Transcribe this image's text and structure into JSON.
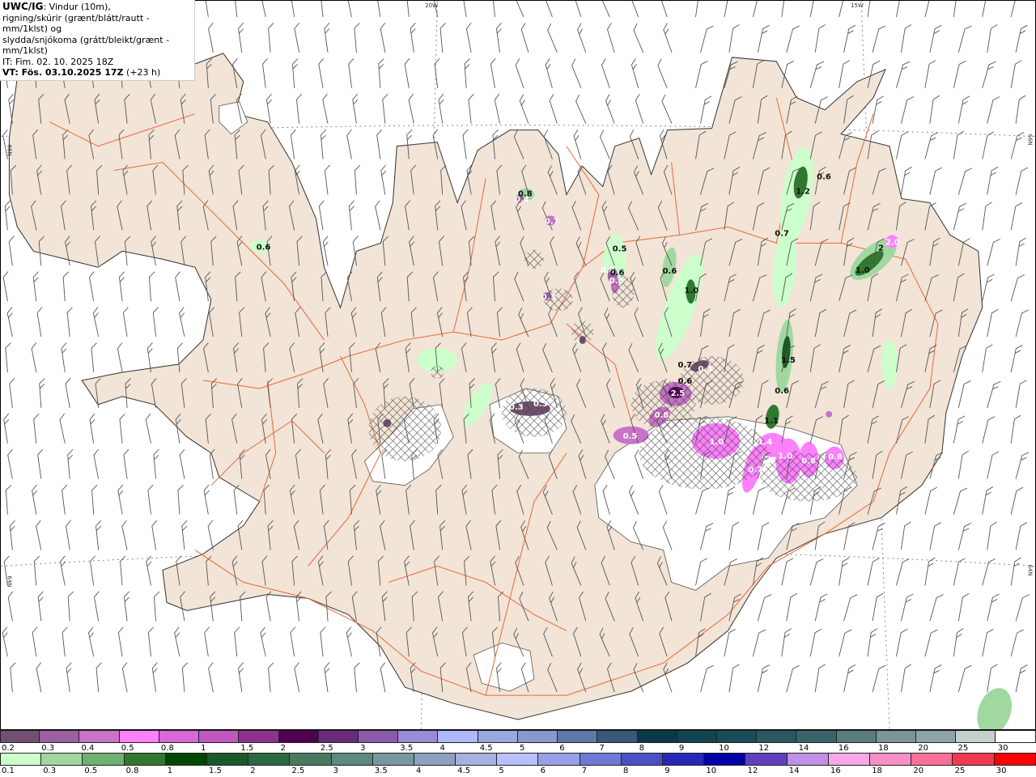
{
  "title": {
    "model": "UWC/IG",
    "line1_rest": ": Vindur (10m),",
    "line2": "rigning/skúrir (grænt/blátt/rautt - mm/1klst) og",
    "line3": "slydda/snjókoma (grátt/bleikt/grænt - mm/1klst)",
    "initial_time": "IT: Fim. 02. 10. 2025 18Z",
    "valid_time": "VT: Fös. 03.10.2025 17Z",
    "lead": " (+23 h)"
  },
  "grid_labels": {
    "lon_20w": "20W",
    "lon_15w": "15W",
    "lat_66n_left": "66N",
    "lat_64n_left": "64N",
    "lat_66n_right": "66N",
    "lat_64n_right": "64N"
  },
  "colors": {
    "land": "#f2e4d6",
    "glacier": "#ffffff",
    "roads": "#e8683a",
    "sea": "#ffffff",
    "wind_barb": "#555555"
  },
  "map_values": [
    "0.6",
    "0.8",
    "0.4",
    "0.7",
    "0.5",
    "0.8",
    "0.6",
    "0.6",
    "0.3",
    "0.6",
    "1.0",
    "1.2",
    "0.6",
    "0.7",
    "1.0",
    "2.0",
    "2",
    "1.5",
    "0.6",
    "0.7",
    "0.4",
    "0.6",
    "2.5",
    "0.8",
    "0.5",
    "1.0",
    "1.1",
    "1.4",
    "1.0",
    "0.7",
    "0.8",
    "0.8",
    "0.3",
    "0.3"
  ],
  "legend_snow": {
    "labels": [
      "0.2",
      "0.3",
      "0.4",
      "0.5",
      "0.8",
      "1",
      "1.5",
      "2",
      "2.5",
      "3",
      "3.5",
      "4",
      "4.5",
      "5",
      "6",
      "7",
      "8",
      "9",
      "10",
      "12",
      "14",
      "16",
      "18",
      "20",
      "25",
      "30"
    ],
    "colors": [
      "#73506f",
      "#9c5fa0",
      "#c873c8",
      "#ff80ff",
      "#d868d8",
      "#c058c0",
      "#903090",
      "#500050",
      "#6a2a7a",
      "#8a5aaa",
      "#9a8ad8",
      "#b0b8ff",
      "#98a8e0",
      "#8a98d0",
      "#6078a8",
      "#3a5878",
      "#0a3a48",
      "#104450",
      "#1a4c58",
      "#2a5860",
      "#3a6468",
      "#5a7c80",
      "#7a9498",
      "#90a4a8",
      "#c4d0d0",
      "#ffffff"
    ]
  },
  "legend_rain": {
    "labels": [
      "0.1",
      "0.3",
      "0.5",
      "0.8",
      "1",
      "1.5",
      "2",
      "2.5",
      "3",
      "3.5",
      "4",
      "4.5",
      "5",
      "6",
      "7",
      "8",
      "9",
      "10",
      "12",
      "14",
      "16",
      "18",
      "20",
      "25",
      "30"
    ],
    "colors": [
      "#ccffcc",
      "#a0d8a0",
      "#70b070",
      "#307830",
      "#004800",
      "#1a5a28",
      "#2a6a40",
      "#487a60",
      "#5a8a80",
      "#7898a0",
      "#90a0c0",
      "#a8b0e0",
      "#b8c0ff",
      "#98a0e8",
      "#7078d8",
      "#4850c8",
      "#2828b8",
      "#0000a8",
      "#6040c0",
      "#c090e8",
      "#f8a8e8",
      "#f890c8",
      "#f87098",
      "#f03850",
      "#ff0000"
    ]
  }
}
